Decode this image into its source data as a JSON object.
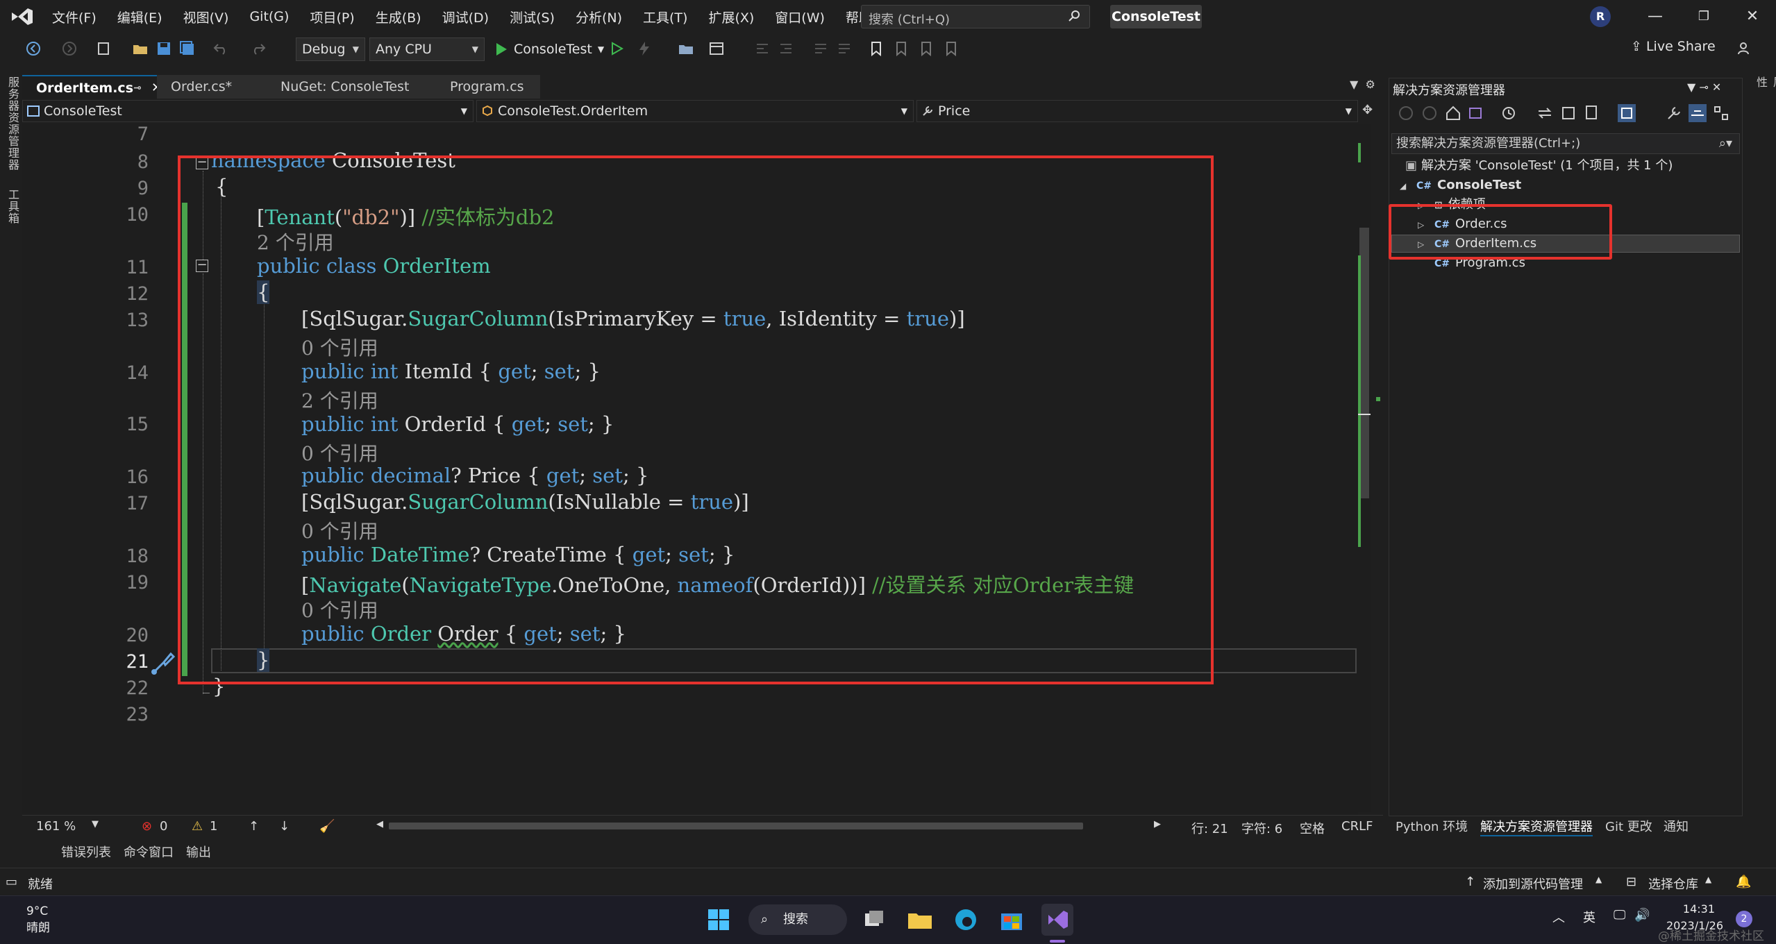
{
  "menu": [
    "文件(F)",
    "编辑(E)",
    "视图(V)",
    "Git(G)",
    "项目(P)",
    "生成(B)",
    "调试(D)",
    "测试(S)",
    "分析(N)",
    "工具(T)",
    "扩展(X)",
    "窗口(W)",
    "帮助(H)"
  ],
  "search_placeholder": "搜索 (Ctrl+Q)",
  "solution_title": "ConsoleTest",
  "user_initial": "R",
  "toolbar": {
    "config": "Debug",
    "platform": "Any CPU",
    "run_target": "ConsoleTest",
    "live_share": "Live Share"
  },
  "left_strip": [
    "服务器资源管理器",
    "工具箱"
  ],
  "tabs": [
    "OrderItem.cs",
    "Order.cs*",
    "NuGet: ConsoleTest",
    "Program.cs"
  ],
  "nav": {
    "project": "ConsoleTest",
    "type": "ConsoleTest.OrderItem",
    "member": "Price"
  },
  "code": {
    "line_numbers": [
      "7",
      "8",
      "9",
      "10",
      "11",
      "12",
      "13",
      "14",
      "15",
      "16",
      "17",
      "18",
      "19",
      "20",
      "21",
      "22",
      "23"
    ],
    "ns_kw": "namespace",
    "ns_name": "ConsoleTest",
    "open_brace": "{",
    "close_brace": "}",
    "tenant_attr": "Tenant",
    "tenant_arg": "\"db2\"",
    "tenant_comment": "//实体标为db2",
    "refs_2": "2 个引用",
    "refs_0": "0 个引用",
    "public": "public",
    "class": "class",
    "class_name": "OrderItem",
    "sqlsugar": "SqlSugar",
    "sugarcolumn": "SugarColumn",
    "is_primary_key": "IsPrimaryKey",
    "is_identity": "IsIdentity",
    "is_nullable": "IsNullable",
    "true": "true",
    "int": "int",
    "decimal": "decimal",
    "datetime": "DateTime",
    "item_id": "ItemId",
    "order_id": "OrderId",
    "price": "Price",
    "create_time": "CreateTime",
    "get": "get",
    "set": "set",
    "navigate": "Navigate",
    "navigate_type": "NavigateType",
    "one_to_one": "OneToOne",
    "nameof": "nameof",
    "nav_comment": "//设置关系 对应Order表主键",
    "order_type": "Order",
    "order_prop": "Order"
  },
  "editor_status": {
    "zoom": "161 %",
    "errors": "0",
    "warnings": "1",
    "line": "行: 21",
    "col": "字符: 6",
    "spaces": "空格",
    "eol": "CRLF"
  },
  "bottom_tabs": [
    "错误列表",
    "命令窗口",
    "输出"
  ],
  "solution_explorer": {
    "title": "解决方案资源管理器",
    "search": "搜索解决方案资源管理器(Ctrl+;)",
    "solution": "解决方案 'ConsoleTest' (1 个项目，共 1 个)",
    "project": "ConsoleTest",
    "items": [
      "依赖项",
      "Order.cs",
      "OrderItem.cs",
      "Program.cs"
    ],
    "bottom_tabs": [
      "Python 环境",
      "解决方案资源管理器",
      "Git 更改",
      "通知"
    ],
    "right_strip": "属性"
  },
  "statusbar": {
    "ready": "就绪",
    "add_source": "添加到源代码管理",
    "select_repo": "选择仓库"
  },
  "taskbar": {
    "temp": "9°C",
    "weather": "晴朗",
    "search": "搜索",
    "ime": "英",
    "time": "14:31",
    "date": "2023/1/26",
    "notif": "2",
    "watermark": "@稀土掘金技术社区"
  },
  "colors": {
    "accent_blue": "#569cd6",
    "type_teal": "#4ec9b0",
    "comment_green": "#57a64a",
    "annotation_red": "#e5322d"
  }
}
